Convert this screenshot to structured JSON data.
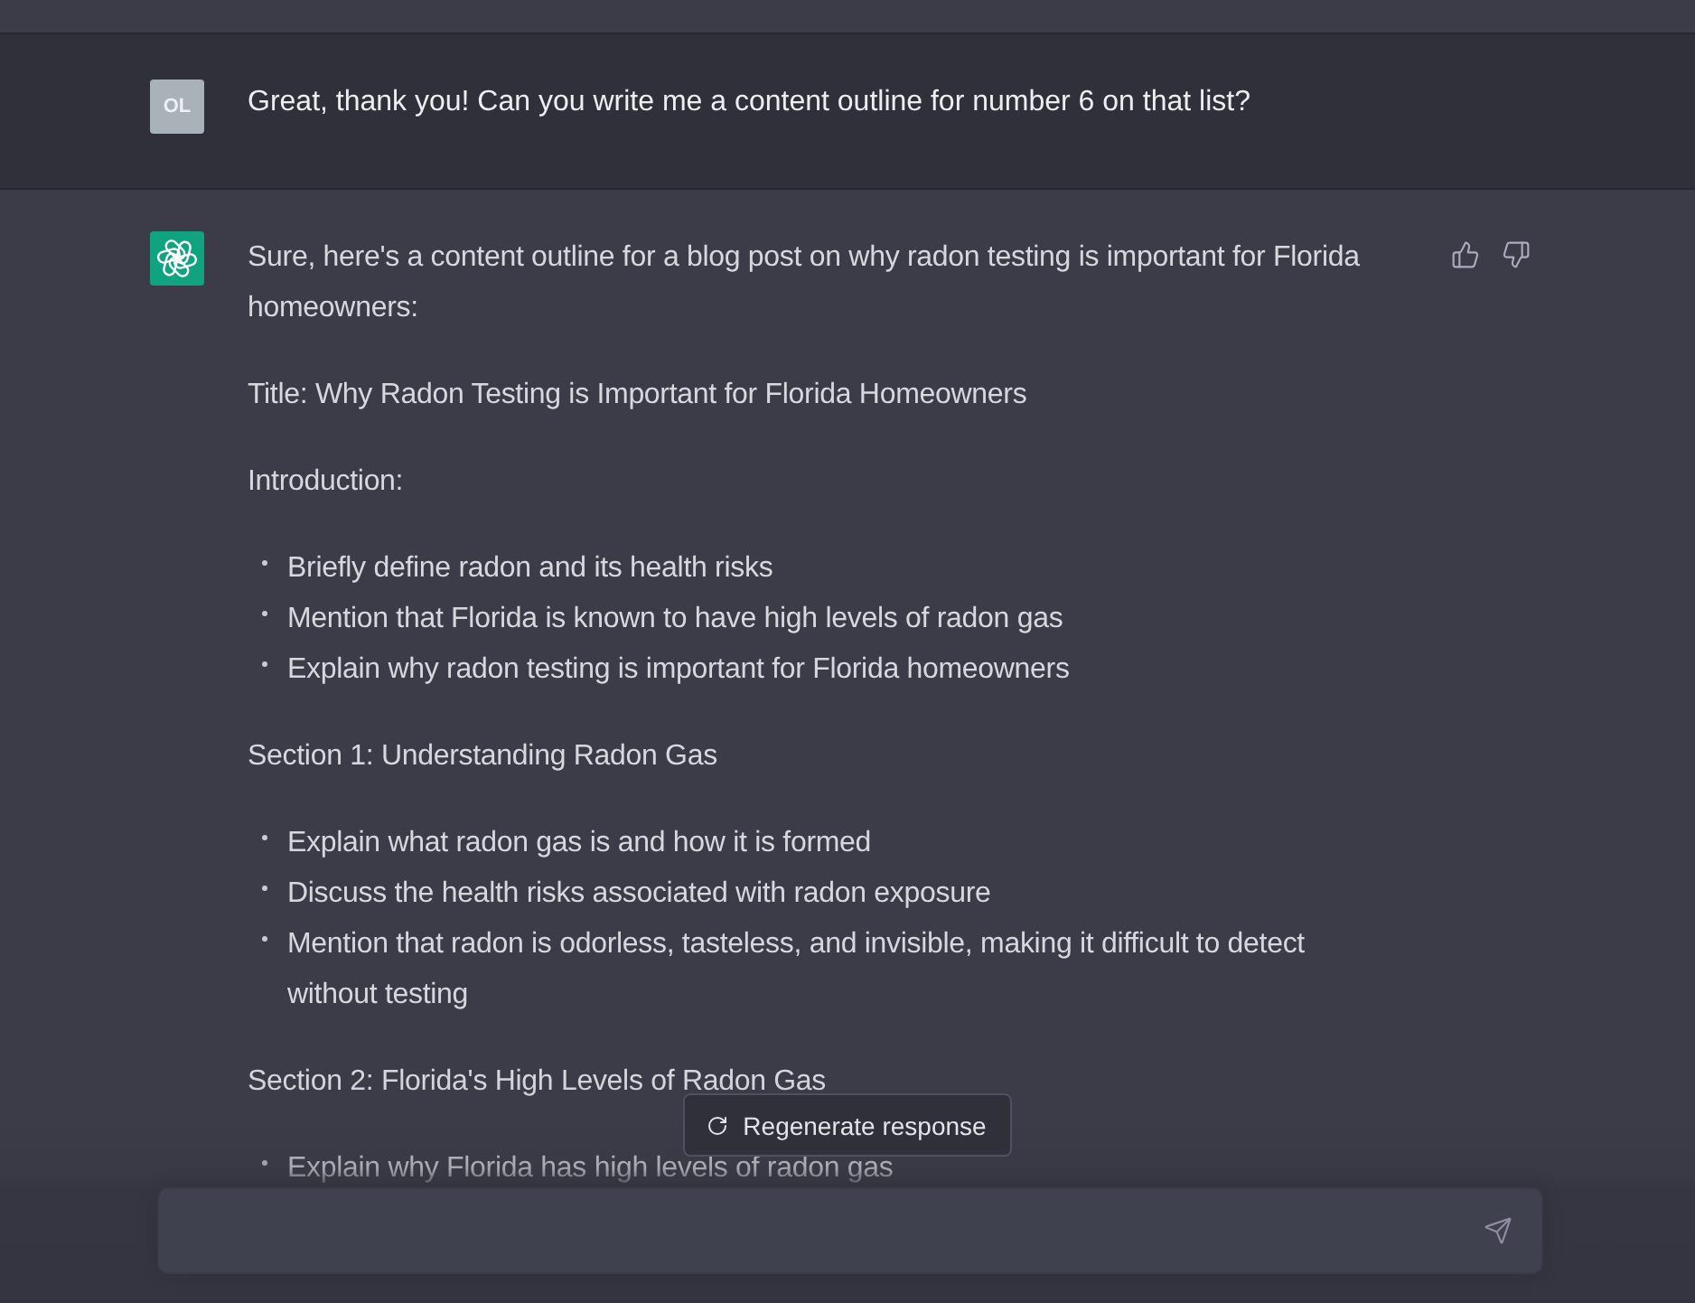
{
  "user_message": {
    "avatar": "OL",
    "text": "Great, thank you! Can you write me a content outline for number 6 on that list?"
  },
  "assistant_message": {
    "blocks": [
      {
        "kind": "paragraph",
        "text": "Sure, here's a content outline for a blog post on why radon testing is important for Florida homeowners:"
      },
      {
        "kind": "paragraph",
        "text": "Title: Why Radon Testing is Important for Florida Homeowners"
      },
      {
        "kind": "paragraph",
        "text": "Introduction:"
      },
      {
        "kind": "bullets",
        "items": [
          "Briefly define radon and its health risks",
          "Mention that Florida is known to have high levels of radon gas",
          "Explain why radon testing is important for Florida homeowners"
        ]
      },
      {
        "kind": "paragraph",
        "text": "Section 1: Understanding Radon Gas"
      },
      {
        "kind": "bullets",
        "items": [
          "Explain what radon gas is and how it is formed",
          "Discuss the health risks associated with radon exposure",
          "Mention that radon is odorless, tasteless, and invisible, making it difficult to detect without testing"
        ]
      },
      {
        "kind": "paragraph",
        "text": "Section 2: Florida's High Levels of Radon Gas"
      },
      {
        "kind": "bullets",
        "items": [
          "Explain why Florida has high levels of radon gas"
        ]
      }
    ]
  },
  "regenerate_button": {
    "label": "Regenerate response"
  }
}
